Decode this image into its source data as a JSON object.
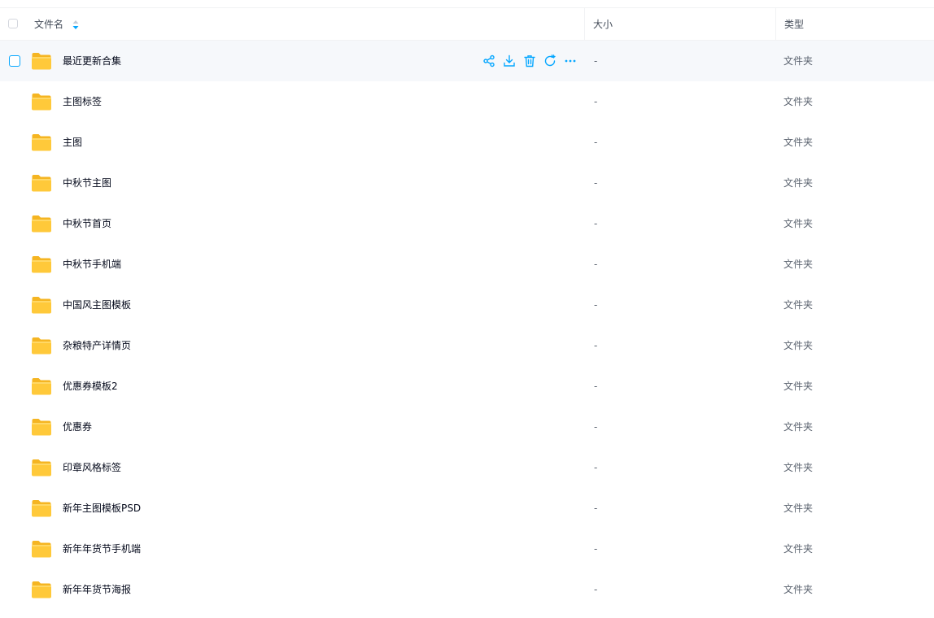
{
  "header": {
    "name_label": "文件名",
    "size_label": "大小",
    "type_label": "类型"
  },
  "colors": {
    "accent": "#06a7ff",
    "folder": "#ffc93a"
  },
  "row_actions": [
    "share-icon",
    "download-icon",
    "delete-icon",
    "refresh-icon",
    "more-icon"
  ],
  "files": [
    {
      "name": "最近更新合集",
      "size": "-",
      "type": "文件夹"
    },
    {
      "name": "主图标签",
      "size": "-",
      "type": "文件夹"
    },
    {
      "name": "主图",
      "size": "-",
      "type": "文件夹"
    },
    {
      "name": "中秋节主图",
      "size": "-",
      "type": "文件夹"
    },
    {
      "name": "中秋节首页",
      "size": "-",
      "type": "文件夹"
    },
    {
      "name": "中秋节手机端",
      "size": "-",
      "type": "文件夹"
    },
    {
      "name": "中国风主图模板",
      "size": "-",
      "type": "文件夹"
    },
    {
      "name": "杂粮特产详情页",
      "size": "-",
      "type": "文件夹"
    },
    {
      "name": "优惠券模板2",
      "size": "-",
      "type": "文件夹"
    },
    {
      "name": "优惠券",
      "size": "-",
      "type": "文件夹"
    },
    {
      "name": "印章风格标签",
      "size": "-",
      "type": "文件夹"
    },
    {
      "name": "新年主图模板PSD",
      "size": "-",
      "type": "文件夹"
    },
    {
      "name": "新年年货节手机端",
      "size": "-",
      "type": "文件夹"
    },
    {
      "name": "新年年货节海报",
      "size": "-",
      "type": "文件夹"
    }
  ]
}
